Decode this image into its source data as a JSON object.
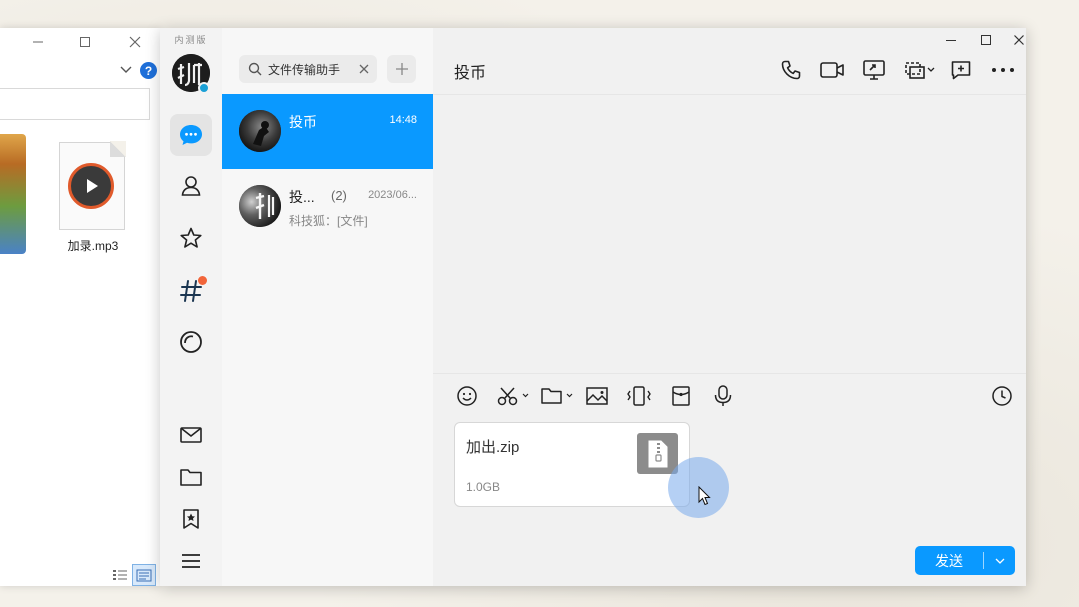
{
  "explorer": {
    "help_label": "?",
    "file_label": "加录.mp3"
  },
  "qq": {
    "beta_label": "内测版",
    "search": {
      "value": "文件传输助手"
    },
    "chats": [
      {
        "name": "投币",
        "time": "14:48",
        "selected": true
      },
      {
        "name": "投...",
        "count": "(2)",
        "time": "2023/06...",
        "preview": "科技狐：[文件]",
        "selected": false
      }
    ],
    "conversation": {
      "title": "投币",
      "attachment": {
        "name": "加出.zip",
        "size": "1.0GB"
      }
    },
    "send_label": "发送",
    "colors": {
      "accent": "#0a99ff",
      "badge": "#f2653a",
      "status_dot": "#1aa0d6"
    }
  }
}
